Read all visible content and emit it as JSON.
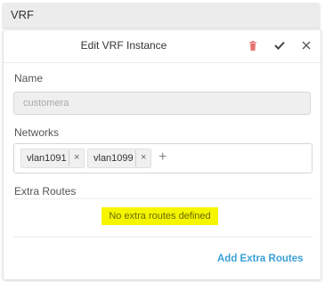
{
  "panel": {
    "title": "VRF"
  },
  "dialog": {
    "title": "Edit VRF Instance"
  },
  "icons": {
    "delete": "trash-icon",
    "confirm": "checkmark-icon",
    "close": "close-icon",
    "remove_tag": "close-icon",
    "add": "plus-icon"
  },
  "colors": {
    "delete_icon": "#e57373",
    "link": "#3ba1d8",
    "highlight": "#f5f500"
  },
  "form": {
    "name_label": "Name",
    "name_value": "customera",
    "networks_label": "Networks",
    "networks": [
      {
        "label": "vlan1091",
        "remove": "×"
      },
      {
        "label": "vlan1099",
        "remove": "×"
      }
    ],
    "add_network": "+",
    "extra_routes_label": "Extra Routes",
    "extra_routes_empty": "No extra routes defined",
    "add_extra_routes": "Add Extra Routes"
  }
}
